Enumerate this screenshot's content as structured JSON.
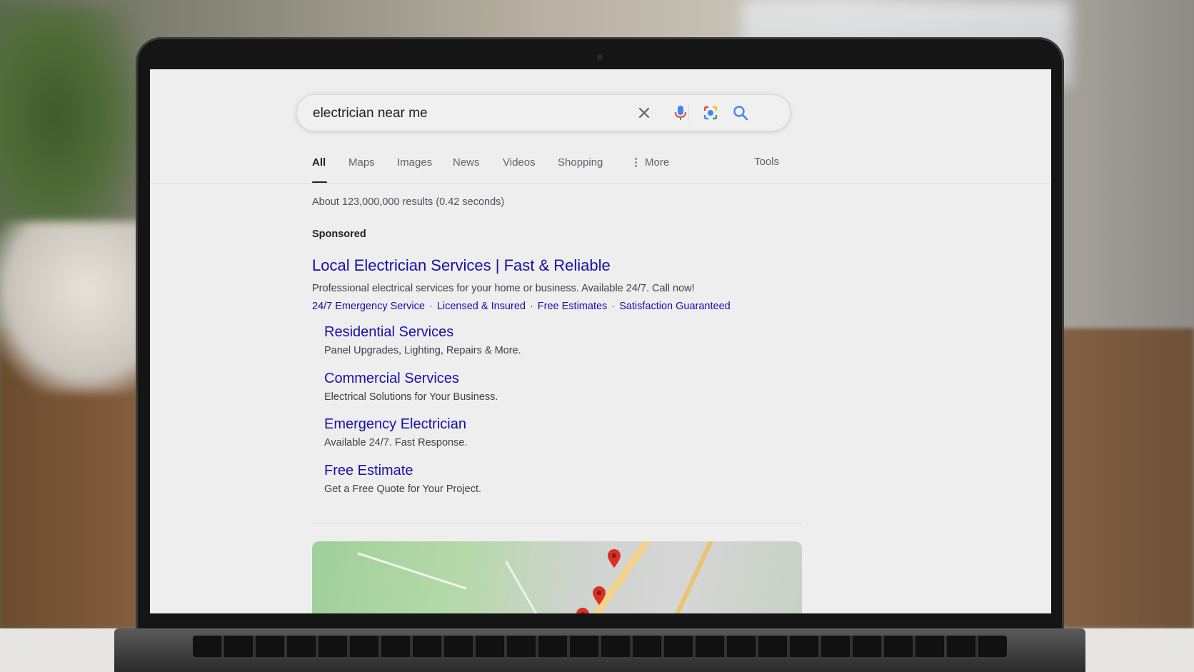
{
  "search": {
    "query": "electrician near me"
  },
  "tabs": [
    {
      "label": "All",
      "active": true
    },
    {
      "label": "Maps"
    },
    {
      "label": "Images"
    },
    {
      "label": "News"
    },
    {
      "label": "Videos"
    },
    {
      "label": "Shopping"
    },
    {
      "label": "More",
      "icon": "more-vert-icon"
    }
  ],
  "tools_label": "Tools",
  "result_stats": "About 123,000,000 results (0.42 seconds)",
  "ad": {
    "sponsored_label": "Sponsored",
    "title": "Local Electrician Services | Fast & Reliable",
    "description": "Professional electrical services for your home or business. Available 24/7. Call now!",
    "extensions": [
      "24/7 Emergency Service",
      "Licensed & Insured",
      "Free Estimates",
      "Satisfaction Guaranteed"
    ],
    "sitelinks": [
      {
        "title": "Residential Services",
        "description": "Panel Upgrades, Lighting, Repairs & More."
      },
      {
        "title": "Commercial Services",
        "description": "Electrical Solutions for Your Business."
      },
      {
        "title": "Emergency Electrician",
        "description": "Available 24/7. Fast Response."
      },
      {
        "title": "Free Estimate",
        "description": "Get a Free Quote for Your Project."
      }
    ]
  },
  "icons": {
    "clear": "close-icon",
    "voice": "microphone-icon",
    "lens": "camera-lens-icon",
    "search": "search-icon",
    "map_pin": "map-pin-icon"
  },
  "colors": {
    "link": "#1a0dab",
    "pin": "#d93025",
    "search_blue": "#4285f4"
  }
}
